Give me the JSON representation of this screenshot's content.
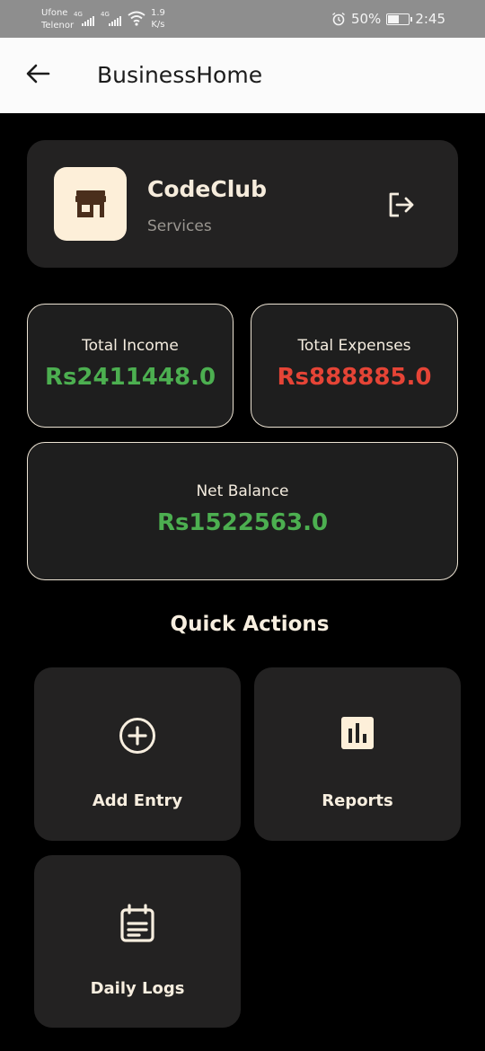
{
  "status_bar": {
    "carrier1": "Ufone",
    "carrier2": "Telenor",
    "net1": "4G",
    "net2": "4G",
    "speed_value": "1.9",
    "speed_unit": "K/s",
    "battery": "50%",
    "time": "2:45"
  },
  "appbar": {
    "title": "BusinessHome"
  },
  "business": {
    "name": "CodeClub",
    "category": "Services"
  },
  "stats": {
    "income_label": "Total Income",
    "income_value": "Rs2411448.0",
    "expenses_label": "Total Expenses",
    "expenses_value": "Rs888885.0",
    "net_label": "Net Balance",
    "net_value": "Rs1522563.0"
  },
  "quick_actions": {
    "title": "Quick Actions",
    "items": [
      {
        "label": "Add Entry",
        "icon": "add-circle-icon"
      },
      {
        "label": "Reports",
        "icon": "bar-chart-icon"
      },
      {
        "label": "Daily Logs",
        "icon": "calendar-note-icon"
      }
    ]
  },
  "colors": {
    "accent_cream": "#fdefd9",
    "income_green": "#4caf50",
    "expense_red": "#e54436",
    "card_bg": "#232222"
  }
}
